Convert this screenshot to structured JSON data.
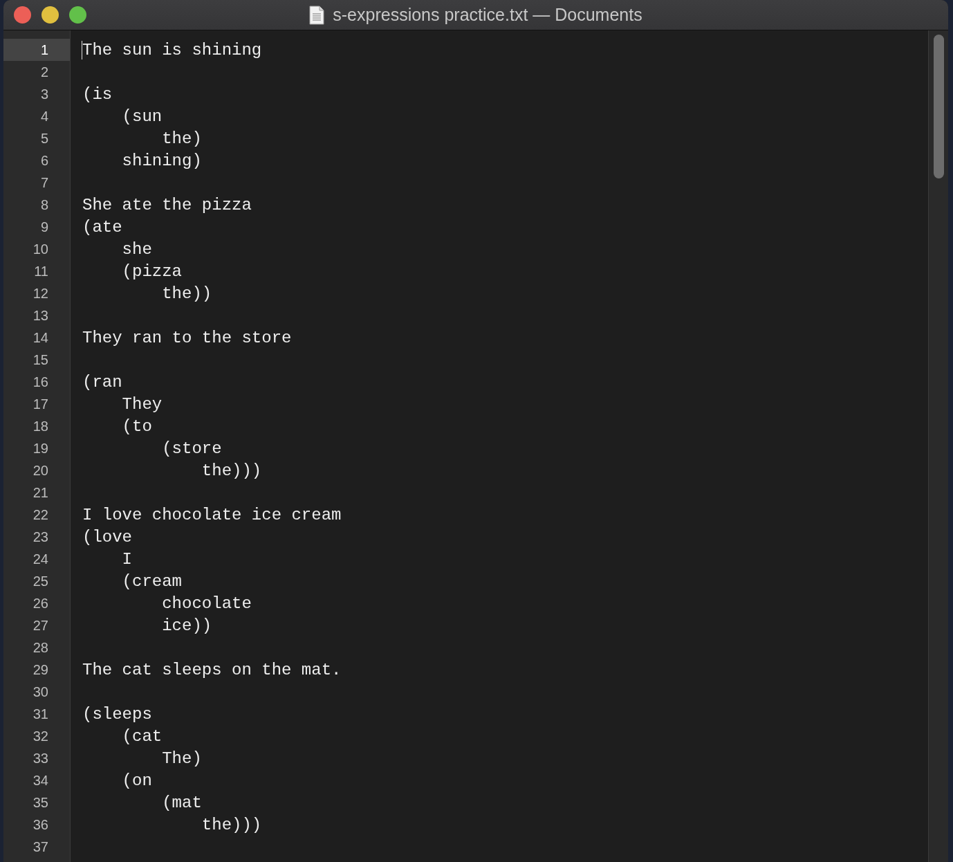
{
  "window": {
    "title": "s-expressions practice.txt — Documents"
  },
  "lines": [
    {
      "number": "1",
      "text": "The sun is shining",
      "current": true
    },
    {
      "number": "2",
      "current": false
    },
    {
      "number": "3",
      "text": "(is",
      "current": false
    },
    {
      "number": "4",
      "text": "    (sun",
      "current": false
    },
    {
      "number": "5",
      "text": "        the)",
      "current": false
    },
    {
      "number": "6",
      "text": "    shining)",
      "current": false
    },
    {
      "number": "7",
      "current": false
    },
    {
      "number": "8",
      "text": "She ate the pizza",
      "current": false
    },
    {
      "number": "9",
      "text": "(ate",
      "current": false
    },
    {
      "number": "10",
      "text": "    she",
      "current": false
    },
    {
      "number": "11",
      "text": "    (pizza",
      "current": false
    },
    {
      "number": "12",
      "text": "        the))",
      "current": false
    },
    {
      "number": "13",
      "current": false
    },
    {
      "number": "14",
      "text": "They ran to the store",
      "current": false
    },
    {
      "number": "15",
      "current": false
    },
    {
      "number": "16",
      "text": "(ran",
      "current": false
    },
    {
      "number": "17",
      "text": "    They",
      "current": false
    },
    {
      "number": "18",
      "text": "    (to",
      "current": false
    },
    {
      "number": "19",
      "text": "        (store",
      "current": false
    },
    {
      "number": "20",
      "text": "            the)))",
      "current": false
    },
    {
      "number": "21",
      "current": false
    },
    {
      "number": "22",
      "text": "I love chocolate ice cream",
      "current": false
    },
    {
      "number": "23",
      "text": "(love",
      "current": false
    },
    {
      "number": "24",
      "text": "    I",
      "current": false
    },
    {
      "number": "25",
      "text": "    (cream",
      "current": false
    },
    {
      "number": "26",
      "text": "        chocolate",
      "current": false
    },
    {
      "number": "27",
      "text": "        ice))",
      "current": false
    },
    {
      "number": "28",
      "current": false
    },
    {
      "number": "29",
      "text": "The cat sleeps on the mat.",
      "current": false
    },
    {
      "number": "30",
      "current": false
    },
    {
      "number": "31",
      "text": "(sleeps",
      "current": false
    },
    {
      "number": "32",
      "text": "    (cat",
      "current": false
    },
    {
      "number": "33",
      "text": "        The)",
      "current": false
    },
    {
      "number": "34",
      "text": "    (on",
      "current": false
    },
    {
      "number": "35",
      "text": "        (mat",
      "current": false
    },
    {
      "number": "36",
      "text": "            the)))",
      "current": false
    },
    {
      "number": "37",
      "current": false
    }
  ]
}
